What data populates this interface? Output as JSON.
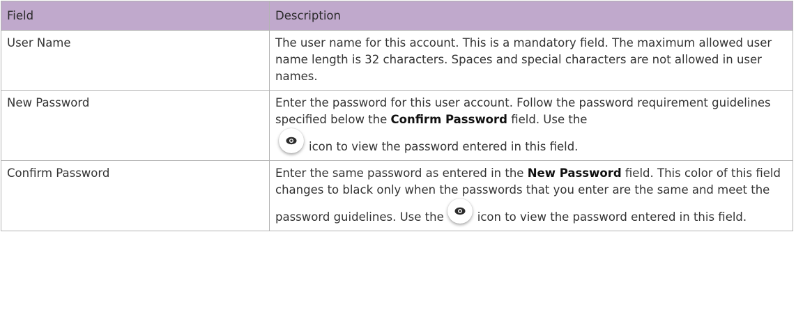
{
  "table": {
    "headers": {
      "field": "Field",
      "description": "Description"
    },
    "rows": [
      {
        "field": "User Name",
        "description": "The user name for this account. This is a mandatory field. The maximum allowed user name length is 32 characters. Spaces and special characters are not allowed in user names."
      },
      {
        "field": "New Password",
        "desc_part1": "Enter the password for this user account. Follow the password requirement guidelines specified below the ",
        "desc_bold": "Confirm Password",
        "desc_part2": " field. Use the",
        "desc_part3": "icon to view the password entered in this field.",
        "icon": "eye-icon"
      },
      {
        "field": "Confirm Password",
        "desc_part1": "Enter the same password as entered in the ",
        "desc_bold": "New Password",
        "desc_part2": " field. This color of this field changes to black only when the passwords that you enter are the same and meet the password guidelines. Use the",
        "desc_part3": "icon to view the password entered in this field.",
        "icon": "eye-icon"
      }
    ]
  },
  "colors": {
    "header_bg": "#c0a9cc",
    "border": "#b3b3b3"
  }
}
